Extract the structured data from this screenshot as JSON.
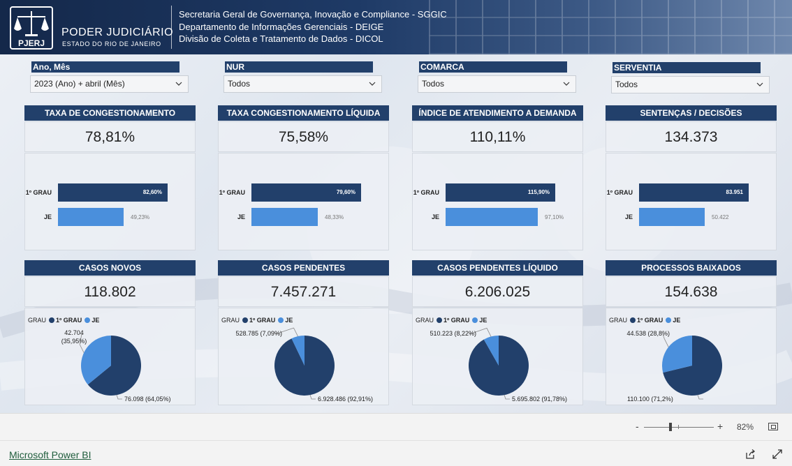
{
  "header": {
    "logo_text": "PJERJ",
    "org_name": "PODER JUDICIÁRIO",
    "org_sub": "ESTADO DO RIO DE JANEIRO",
    "dept_lines": [
      "Secretaria Geral de Governança, Inovação e Compliance - SGGIC",
      "Departamento de Informações Gerenciais - DEIGE",
      "Divisão de Coleta e Tratamento de Dados - DICOL"
    ]
  },
  "filters": [
    {
      "label": "Ano, Mês",
      "value": "2023 (Ano) + abril (Mês)"
    },
    {
      "label": "NUR",
      "value": "Todos"
    },
    {
      "label": "COMARCA",
      "value": "Todos"
    },
    {
      "label": "SERVENTIA",
      "value": "Todos"
    }
  ],
  "colors": {
    "primary": "#22406b",
    "dark_series": "#22406b",
    "light_series": "#4a8fdc"
  },
  "bar_cards": [
    {
      "title": "TAXA DE CONGESTIONAMENTO",
      "value": "78,81%",
      "rows": [
        {
          "label": "1º GRAU",
          "value": 82.6,
          "text": "82,60%"
        },
        {
          "label": "JE",
          "value": 49.23,
          "text": "49,23%"
        }
      ]
    },
    {
      "title": "TAXA CONGESTIONAMENTO LÍQUIDA",
      "value": "75,58%",
      "rows": [
        {
          "label": "1º GRAU",
          "value": 79.6,
          "text": "79,60%"
        },
        {
          "label": "JE",
          "value": 48.33,
          "text": "48,33%"
        }
      ]
    },
    {
      "title": "ÍNDICE DE ATENDIMENTO A DEMANDA",
      "value": "110,11%",
      "rows": [
        {
          "label": "1º GRAU",
          "value": 115.9,
          "text": "115,90%"
        },
        {
          "label": "JE",
          "value": 97.1,
          "text": "97,10%"
        }
      ]
    },
    {
      "title": "SENTENÇAS / DECISÕES",
      "value": "134.373",
      "rows": [
        {
          "label": "1º GRAU",
          "value": 83951,
          "text": "83.951"
        },
        {
          "label": "JE",
          "value": 50422,
          "text": "50.422"
        }
      ]
    }
  ],
  "pie_cards": [
    {
      "title": "CASOS NOVOS",
      "value": "118.802",
      "legend": {
        "title": "GRAU",
        "items": [
          "1º GRAU",
          "JE"
        ]
      },
      "slices": [
        {
          "name": "1º GRAU",
          "value": 76098,
          "label": "76.098 (64,05%)"
        },
        {
          "name": "JE",
          "value": 42704,
          "label": "42.704 (35,95%)"
        }
      ]
    },
    {
      "title": "CASOS PENDENTES",
      "value": "7.457.271",
      "legend": {
        "title": "GRAU",
        "items": [
          "1º GRAU",
          "JE"
        ]
      },
      "slices": [
        {
          "name": "1º GRAU",
          "value": 6928486,
          "label": "6.928.486 (92,91%)"
        },
        {
          "name": "JE",
          "value": 528785,
          "label": "528.785 (7,09%)"
        }
      ]
    },
    {
      "title": "CASOS PENDENTES LÍQUIDO",
      "value": "6.206.025",
      "legend": {
        "title": "GRAU",
        "items": [
          "1º GRAU",
          "JE"
        ]
      },
      "slices": [
        {
          "name": "1º GRAU",
          "value": 5695802,
          "label": "5.695.802 (91,78%)"
        },
        {
          "name": "JE",
          "value": 510223,
          "label": "510.223 (8,22%)"
        }
      ]
    },
    {
      "title": "PROCESSOS BAIXADOS",
      "value": "154.638",
      "legend": {
        "title": "GRAU",
        "items": [
          "1º GRAU",
          "JE"
        ]
      },
      "slices": [
        {
          "name": "1º GRAU",
          "value": 110100,
          "label": "110.100 (71,2%)"
        },
        {
          "name": "JE",
          "value": 44538,
          "label": "44.538 (28,8%)"
        }
      ]
    }
  ],
  "statusbar": {
    "zoom_minus": "-",
    "zoom_plus": "+",
    "zoom": "82%"
  },
  "footer": {
    "link": "Microsoft Power BI"
  }
}
